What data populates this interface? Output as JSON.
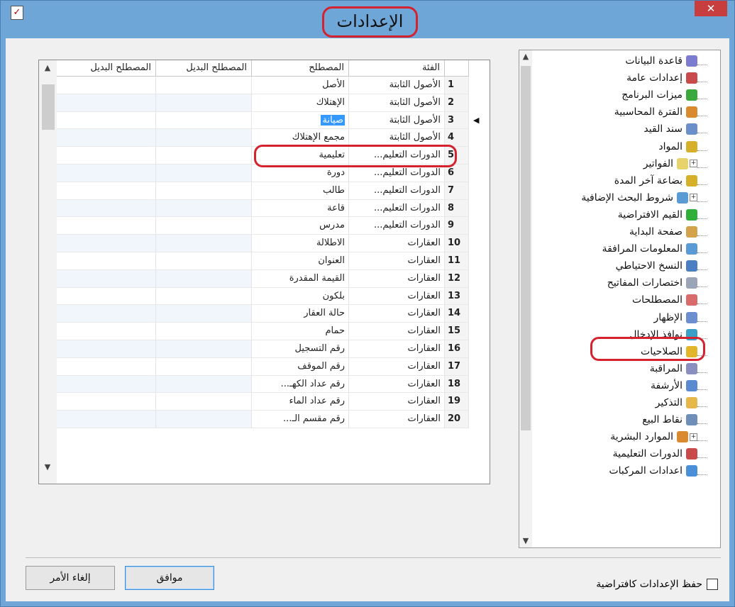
{
  "window": {
    "title": "الإعدادات",
    "close_symbol": "✕"
  },
  "tree": {
    "items": [
      {
        "label": "قاعدة البيانات",
        "icon": "database-icon",
        "color": "#7b7bd0",
        "expander": false
      },
      {
        "label": "إعدادات عامة",
        "icon": "checklist-icon",
        "color": "#c94a4a",
        "expander": false
      },
      {
        "label": "ميزات البرنامج",
        "icon": "puzzle-icon",
        "color": "#3aa83a",
        "expander": false
      },
      {
        "label": "الفترة المحاسبية",
        "icon": "calendar-icon",
        "color": "#d98a2f",
        "expander": false
      },
      {
        "label": "سند القيد",
        "icon": "document-icon",
        "color": "#6b8fc9",
        "expander": false
      },
      {
        "label": "المواد",
        "icon": "box-icon",
        "color": "#d7b02a",
        "expander": false
      },
      {
        "label": "الفواتير",
        "icon": "invoice-icon",
        "color": "#e6d36b",
        "expander": true
      },
      {
        "label": "بضاعة آخر المدة",
        "icon": "box-icon",
        "color": "#d7b02a",
        "expander": false
      },
      {
        "label": "شروط البحث الإضافية",
        "icon": "search-icon",
        "color": "#5b9bd5",
        "expander": true
      },
      {
        "label": "القيم الافتراضية",
        "icon": "checkmark-icon",
        "color": "#2fae3a",
        "expander": false
      },
      {
        "label": "صفحة البداية",
        "icon": "brush-icon",
        "color": "#d3a24a",
        "expander": false
      },
      {
        "label": "المعلومات المرافقة",
        "icon": "info-icon",
        "color": "#5b9bd5",
        "expander": false
      },
      {
        "label": "النسخ الاحتياطي",
        "icon": "backup-icon",
        "color": "#4a7fc4",
        "expander": false
      },
      {
        "label": "اختصارات المفاتيح",
        "icon": "keyboard-icon",
        "color": "#9aa6b8",
        "expander": false
      },
      {
        "label": "المصطلحات",
        "icon": "glossary-icon",
        "color": "#d96b6b",
        "expander": false
      },
      {
        "label": "الإظهار",
        "icon": "display-icon",
        "color": "#6d8fd0",
        "expander": false
      },
      {
        "label": "نوافذ الإدخال",
        "icon": "edit-window-icon",
        "color": "#3aa0c8",
        "expander": false
      },
      {
        "label": "الصلاحيات",
        "icon": "lock-icon",
        "color": "#e2b52a",
        "expander": false
      },
      {
        "label": "المراقبة",
        "icon": "monitor-icon",
        "color": "#8a8fc0",
        "expander": false
      },
      {
        "label": "الأرشفة",
        "icon": "archive-icon",
        "color": "#5a8bd0",
        "expander": false
      },
      {
        "label": "التذكير",
        "icon": "bell-icon",
        "color": "#e6b84a",
        "expander": false
      },
      {
        "label": "نقاط البيع",
        "icon": "pos-icon",
        "color": "#6f8fb8",
        "expander": false
      },
      {
        "label": "الموارد البشرية",
        "icon": "people-icon",
        "color": "#d98a2f",
        "expander": true
      },
      {
        "label": "الدورات التعليمية",
        "icon": "checklist-icon",
        "color": "#c94a4a",
        "expander": false
      },
      {
        "label": "اعدادات المركبات",
        "icon": "vehicle-icon",
        "color": "#4a8fd8",
        "expander": false
      }
    ]
  },
  "grid": {
    "headers": {
      "category": "الفئة",
      "term": "المصطلح",
      "alt1": "المصطلح البديل",
      "alt2": "المصطلح البديل"
    },
    "rows": [
      {
        "num": "1",
        "category": "الأصول الثابتة",
        "term": "الأصل"
      },
      {
        "num": "2",
        "category": "الأصول الثابتة",
        "term": "الإهتلاك"
      },
      {
        "num": "3",
        "category": "الأصول الثابتة",
        "term": "صيانة"
      },
      {
        "num": "4",
        "category": "الأصول الثابتة",
        "term": "مجمع الإهتلاك"
      },
      {
        "num": "5",
        "category": "الدورات التعليم...",
        "term": "تعليمية"
      },
      {
        "num": "6",
        "category": "الدورات التعليم...",
        "term": "دورة"
      },
      {
        "num": "7",
        "category": "الدورات التعليم...",
        "term": "طالب"
      },
      {
        "num": "8",
        "category": "الدورات التعليم...",
        "term": "قاعة"
      },
      {
        "num": "9",
        "category": "الدورات التعليم...",
        "term": "مدرس"
      },
      {
        "num": "10",
        "category": "العقارات",
        "term": "الاطلالة"
      },
      {
        "num": "11",
        "category": "العقارات",
        "term": "العنوان"
      },
      {
        "num": "12",
        "category": "العقارات",
        "term": "القيمة المقدرة"
      },
      {
        "num": "13",
        "category": "العقارات",
        "term": "بلكون"
      },
      {
        "num": "14",
        "category": "العقارات",
        "term": "حالة العقار"
      },
      {
        "num": "15",
        "category": "العقارات",
        "term": "حمام"
      },
      {
        "num": "16",
        "category": "العقارات",
        "term": "رقم التسجيل"
      },
      {
        "num": "17",
        "category": "العقارات",
        "term": "رقم الموقف"
      },
      {
        "num": "18",
        "category": "العقارات",
        "term": "رقم عداد الكهـ..."
      },
      {
        "num": "19",
        "category": "العقارات",
        "term": "رقم عداد الماء"
      },
      {
        "num": "20",
        "category": "العقارات",
        "term": "رقم مقسم الـ..."
      }
    ]
  },
  "footer": {
    "save_default_label": "حفظ الإعدادات كافتراضية",
    "ok_label": "موافق",
    "cancel_label": "إلغاء الأمر"
  }
}
